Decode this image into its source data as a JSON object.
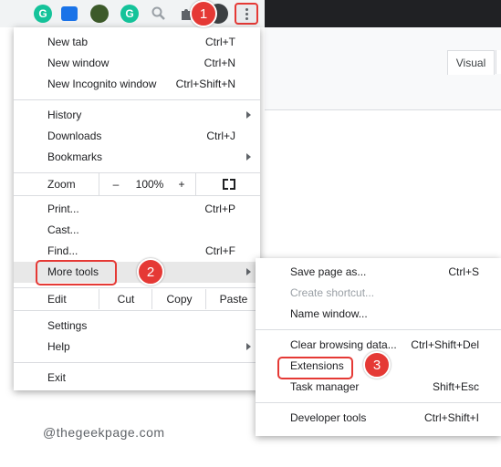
{
  "toolbar": {
    "extensions": [
      "grammarly-icon",
      "reader-icon",
      "leaf-icon",
      "google-icon",
      "search-icon",
      "puzzle-icon",
      "profile-avatar"
    ],
    "menu_icon": "kebab-menu-icon"
  },
  "page": {
    "tab_label": "Visual"
  },
  "menu": {
    "new_tab": {
      "label": "New tab",
      "shortcut": "Ctrl+T"
    },
    "new_window": {
      "label": "New window",
      "shortcut": "Ctrl+N"
    },
    "new_incognito": {
      "label": "New Incognito window",
      "shortcut": "Ctrl+Shift+N"
    },
    "history": {
      "label": "History"
    },
    "downloads": {
      "label": "Downloads",
      "shortcut": "Ctrl+J"
    },
    "bookmarks": {
      "label": "Bookmarks"
    },
    "zoom": {
      "label": "Zoom",
      "minus": "–",
      "value": "100%",
      "plus": "+"
    },
    "print": {
      "label": "Print...",
      "shortcut": "Ctrl+P"
    },
    "cast": {
      "label": "Cast..."
    },
    "find": {
      "label": "Find...",
      "shortcut": "Ctrl+F"
    },
    "more_tools": {
      "label": "More tools"
    },
    "edit": {
      "label": "Edit",
      "cut": "Cut",
      "copy": "Copy",
      "paste": "Paste"
    },
    "settings": {
      "label": "Settings"
    },
    "help": {
      "label": "Help"
    },
    "exit": {
      "label": "Exit"
    }
  },
  "submenu": {
    "save_page": {
      "label": "Save page as...",
      "shortcut": "Ctrl+S"
    },
    "create_shortcut": {
      "label": "Create shortcut..."
    },
    "name_window": {
      "label": "Name window..."
    },
    "clear_browsing": {
      "label": "Clear browsing data...",
      "shortcut": "Ctrl+Shift+Del"
    },
    "extensions": {
      "label": "Extensions"
    },
    "task_manager": {
      "label": "Task manager",
      "shortcut": "Shift+Esc"
    },
    "developer_tools": {
      "label": "Developer tools",
      "shortcut": "Ctrl+Shift+I"
    }
  },
  "annotations": {
    "step1": "1",
    "step2": "2",
    "step3": "3"
  },
  "watermark": "@thegeekpage.com",
  "colors": {
    "annotation_red": "#e53935",
    "toolbar_dark": "#202124",
    "menu_highlight": "#e8e8e8"
  }
}
